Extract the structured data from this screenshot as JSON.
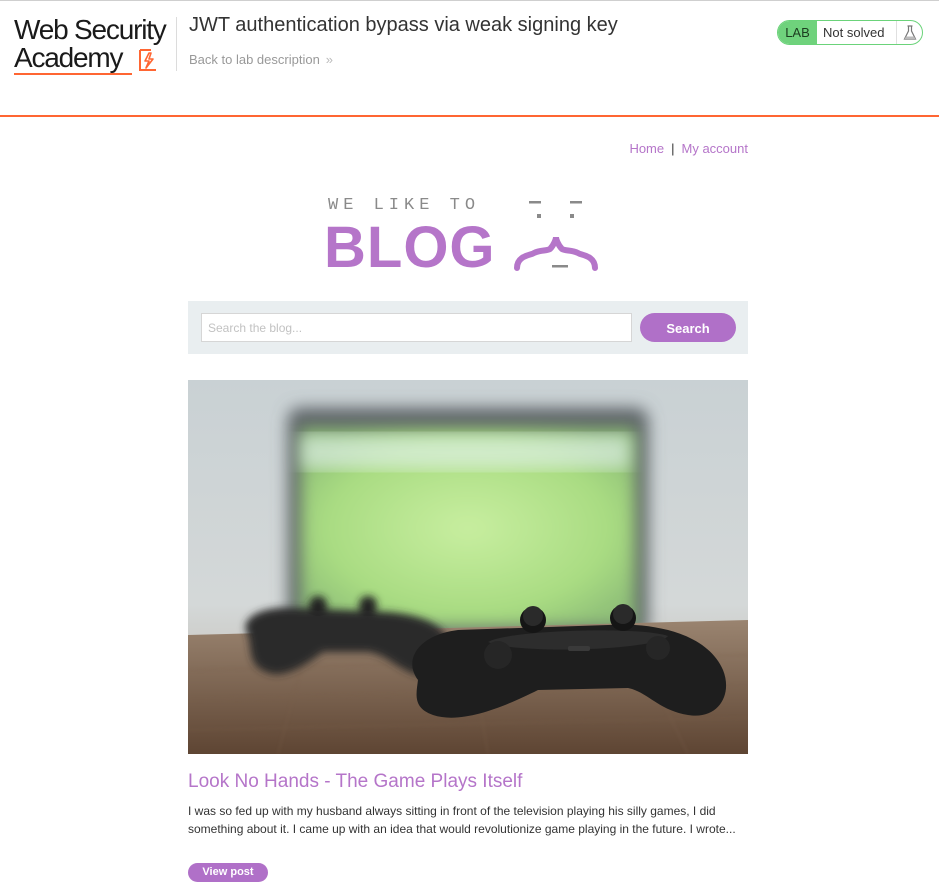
{
  "academy": {
    "logo_line1": "Web Security",
    "logo_line2": "Academy",
    "lab_title": "JWT authentication bypass via weak signing key",
    "back_link": "Back to lab description",
    "back_chevron": "»",
    "status_tag": "LAB",
    "status_text": "Not solved",
    "brand_color": "#ff6633",
    "solved_tag_color": "#6fd27c"
  },
  "nav": {
    "home": "Home",
    "separator": "|",
    "my_account": "My account"
  },
  "blog_header": {
    "tagline": "WE LIKE TO",
    "word": "BLOG",
    "accent_color": "#b575c9"
  },
  "search": {
    "placeholder": "Search the blog...",
    "button": "Search"
  },
  "post": {
    "image_icon": "game-controllers-photo",
    "title": "Look No Hands - The Game Plays Itself",
    "excerpt": "I was so fed up with my husband always sitting in front of the television playing his silly games, I did something about it. I came up with an idea that would revolutionize game playing in the future. I wrote...",
    "button": "View post"
  }
}
